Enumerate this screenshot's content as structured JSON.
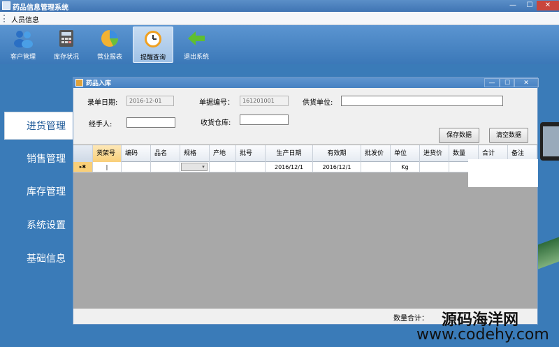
{
  "window": {
    "title": "药品信息管理系统",
    "min": "—",
    "max": "☐",
    "close": "✕"
  },
  "menu": {
    "items": [
      "人员信息"
    ]
  },
  "toolbar": {
    "items": [
      {
        "label": "客户管理",
        "icon": "users-icon"
      },
      {
        "label": "库存状况",
        "icon": "calculator-icon"
      },
      {
        "label": "营业报表",
        "icon": "pie-chart-icon"
      },
      {
        "label": "提醒查询",
        "icon": "clock-icon",
        "active": true
      },
      {
        "label": "退出系统",
        "icon": "back-arrow-icon"
      }
    ]
  },
  "sidebar": {
    "items": [
      {
        "label": "进货管理",
        "active": true
      },
      {
        "label": "销售管理"
      },
      {
        "label": "库存管理"
      },
      {
        "label": "系统设置"
      },
      {
        "label": "基础信息"
      }
    ]
  },
  "child": {
    "title": "药品入库",
    "min": "—",
    "max": "☐",
    "close": "✕",
    "form": {
      "date_label": "录单日期:",
      "date_value": "2016-12-01",
      "order_label": "单据编号：",
      "order_value": "161201001",
      "supplier_label": "供货单位:",
      "supplier_value": "",
      "handler_label": "经手人:",
      "handler_value": "",
      "warehouse_label": "收货仓库:",
      "warehouse_value": ""
    },
    "buttons": {
      "save": "保存数据",
      "clear": "清空数据"
    },
    "grid": {
      "columns": [
        "货架号",
        "编码",
        "品名",
        "规格",
        "产地",
        "批号",
        "生产日期",
        "有效期",
        "批发价",
        "单位",
        "进货价",
        "数量",
        "合计",
        "备注"
      ],
      "row": {
        "indicator": "▸✱",
        "shelf": "|",
        "prod_date": "2016/12/1",
        "expiry": "2016/12/1",
        "unit": "Kg"
      }
    },
    "footer": {
      "sum_label": "数量合计："
    }
  },
  "watermark": {
    "line1": "源码海洋网",
    "line2": "www.codehy.com"
  }
}
